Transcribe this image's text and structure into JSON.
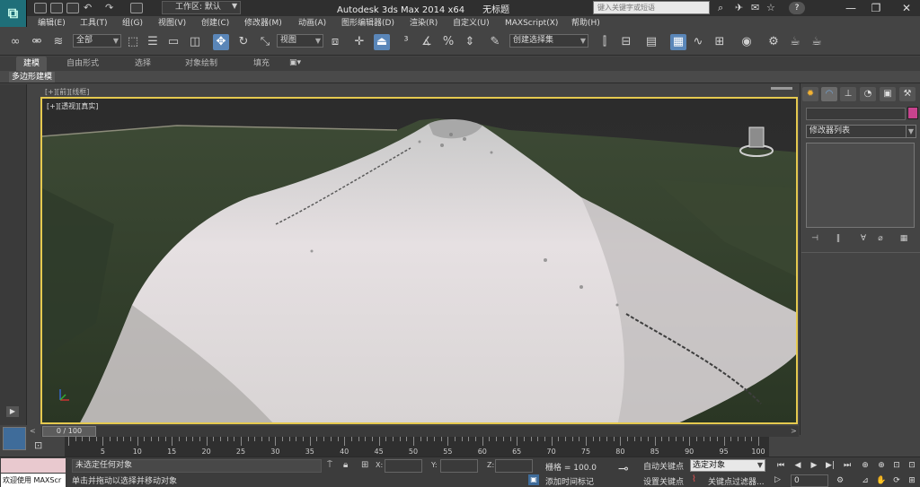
{
  "titlebar": {
    "workspace": "工作区: 默认",
    "app_title": "Autodesk 3ds Max  2014 x64",
    "file_title": "无标题",
    "search_placeholder": "键入关键字或短语"
  },
  "menu": [
    "编辑(E)",
    "工具(T)",
    "组(G)",
    "视图(V)",
    "创建(C)",
    "修改器(M)",
    "动画(A)",
    "图形编辑器(D)",
    "渲染(R)",
    "自定义(U)",
    "MAXScript(X)",
    "帮助(H)"
  ],
  "toolbar": {
    "selection_filter": "全部",
    "ref_coord": "视图",
    "named_selection": "创建选择集"
  },
  "ribbon": {
    "tabs": [
      "建模",
      "自由形式",
      "选择",
      "对象绘制",
      "填充"
    ],
    "sub_label": "多边形建模"
  },
  "viewport": {
    "header": "[+][前][线框]",
    "label": "[+][透视][真实]"
  },
  "command_panel": {
    "modifier_list": "修改器列表"
  },
  "timeline": {
    "slider_label": "0 / 100",
    "ticks": [
      0,
      5,
      10,
      15,
      20,
      25,
      30,
      35,
      40,
      45,
      50,
      55,
      60,
      65,
      70,
      75,
      80,
      85,
      90,
      95,
      100
    ]
  },
  "status": {
    "maxscript": "欢迎使用 MAXScr",
    "prompt1": "未选定任何对象",
    "prompt2": "单击并拖动以选择并移动对象",
    "x_label": "X:",
    "y_label": "Y:",
    "z_label": "Z:",
    "grid": "栅格 = 100.0",
    "add_tag": "添加时间标记",
    "auto_key": "自动关键点",
    "set_key": "设置关键点",
    "selected_objects": "选定对象",
    "key_filter": "关键点过滤器...",
    "frame": "0"
  },
  "colors": {
    "viewport_border": "#e5c94f",
    "active_button": "#5a86b8",
    "object_color": "#c8438e"
  }
}
